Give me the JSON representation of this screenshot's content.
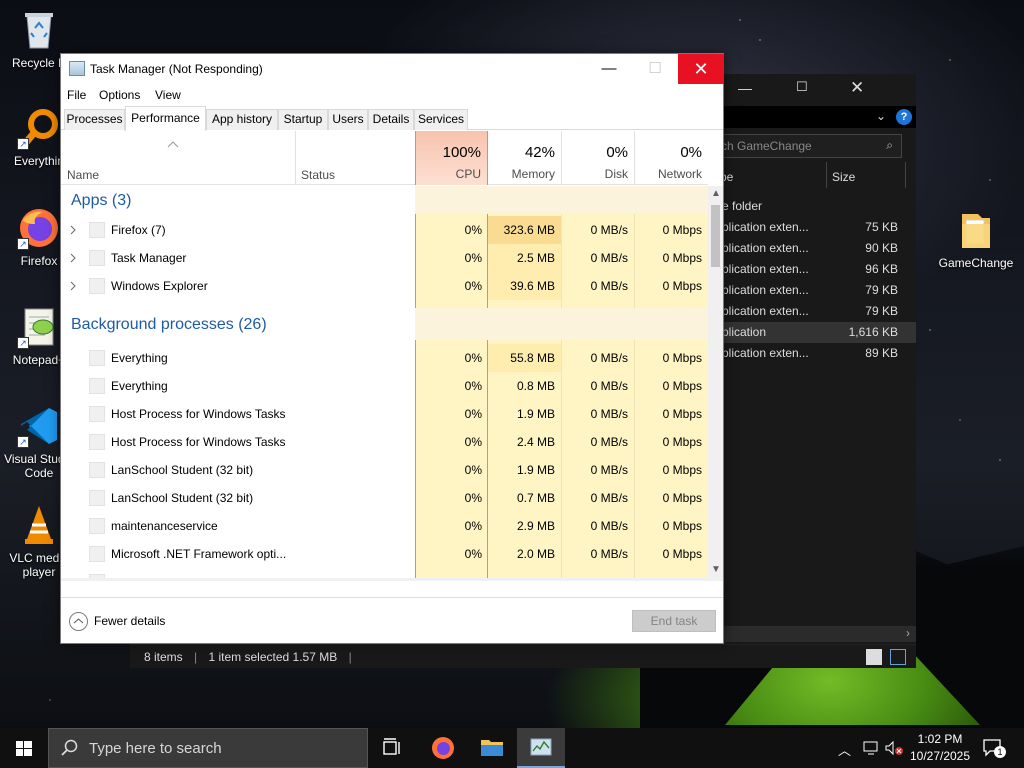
{
  "desktop": {
    "icons": [
      {
        "label": "Recycle B",
        "icon": "recycle-bin-icon"
      },
      {
        "label": "Everythin",
        "icon": "everything-search-icon"
      },
      {
        "label": "Firefox",
        "icon": "firefox-icon"
      },
      {
        "label": "Notepad+",
        "icon": "notepad-plus-plus-icon"
      },
      {
        "label": "Visual Studio Code",
        "icon": "vscode-icon"
      },
      {
        "label": "VLC media player",
        "icon": "vlc-icon"
      },
      {
        "label": "GameChange",
        "icon": "folder-icon"
      }
    ]
  },
  "explorer": {
    "search_placeholder": "rch GameChange",
    "col_type": "pe",
    "col_size": "Size",
    "items": [
      {
        "type": "e folder",
        "size": ""
      },
      {
        "type": "plication exten...",
        "size": "75 KB"
      },
      {
        "type": "plication exten...",
        "size": "90 KB"
      },
      {
        "type": "plication exten...",
        "size": "96 KB"
      },
      {
        "type": "plication exten...",
        "size": "79 KB"
      },
      {
        "type": "plication exten...",
        "size": "79 KB"
      },
      {
        "type": "plication",
        "size": "1,616 KB",
        "selected": true
      },
      {
        "type": "plication exten...",
        "size": "89 KB"
      }
    ],
    "status": {
      "count": "8 items",
      "selection": "1 item selected  1.57 MB"
    }
  },
  "task_manager": {
    "title": "Task Manager (Not Responding)",
    "menu": [
      "File",
      "Options",
      "View"
    ],
    "tabs": [
      "Processes",
      "Performance",
      "App history",
      "Startup",
      "Users",
      "Details",
      "Services"
    ],
    "active_tab": "Performance",
    "columns": {
      "name": "Name",
      "status": "Status",
      "cpu": {
        "pct": "100%",
        "label": "CPU"
      },
      "memory": {
        "pct": "42%",
        "label": "Memory"
      },
      "disk": {
        "pct": "0%",
        "label": "Disk"
      },
      "network": {
        "pct": "0%",
        "label": "Network"
      }
    },
    "groups": {
      "apps": "Apps (3)",
      "background": "Background processes (26)"
    },
    "apps": [
      {
        "name": "Firefox (7)",
        "cpu": "0%",
        "memory": "323.6 MB",
        "disk": "0 MB/s",
        "network": "0 Mbps"
      },
      {
        "name": "Task Manager",
        "cpu": "0%",
        "memory": "2.5 MB",
        "disk": "0 MB/s",
        "network": "0 Mbps"
      },
      {
        "name": "Windows Explorer",
        "cpu": "0%",
        "memory": "39.6 MB",
        "disk": "0 MB/s",
        "network": "0 Mbps"
      }
    ],
    "background": [
      {
        "name": "Everything",
        "cpu": "0%",
        "memory": "55.8 MB",
        "disk": "0 MB/s",
        "network": "0 Mbps"
      },
      {
        "name": "Everything",
        "cpu": "0%",
        "memory": "0.8 MB",
        "disk": "0 MB/s",
        "network": "0 Mbps"
      },
      {
        "name": "Host Process for Windows Tasks",
        "cpu": "0%",
        "memory": "1.9 MB",
        "disk": "0 MB/s",
        "network": "0 Mbps"
      },
      {
        "name": "Host Process for Windows Tasks",
        "cpu": "0%",
        "memory": "2.4 MB",
        "disk": "0 MB/s",
        "network": "0 Mbps"
      },
      {
        "name": "LanSchool Student (32 bit)",
        "cpu": "0%",
        "memory": "1.9 MB",
        "disk": "0 MB/s",
        "network": "0 Mbps"
      },
      {
        "name": "LanSchool Student (32 bit)",
        "cpu": "0%",
        "memory": "0.7 MB",
        "disk": "0 MB/s",
        "network": "0 Mbps"
      },
      {
        "name": "maintenanceservice",
        "cpu": "0%",
        "memory": "2.9 MB",
        "disk": "0 MB/s",
        "network": "0 Mbps"
      },
      {
        "name": "Microsoft .NET Framework opti...",
        "cpu": "0%",
        "memory": "2.0 MB",
        "disk": "0 MB/s",
        "network": "0 Mbps"
      }
    ],
    "fewer_details": "Fewer details",
    "end_task": "End task"
  },
  "taskbar": {
    "search_placeholder": "Type here to search",
    "time": "1:02 PM",
    "date": "10/27/2025",
    "notification_count": "1"
  },
  "colors": {
    "cpu_header": "#f8c3ae",
    "heat_light": "#fff4c4",
    "heat_mid": "#ffedb0",
    "heat_strong": "#f9db91",
    "close_red": "#e81123",
    "group_blue": "#1f5aa6"
  }
}
